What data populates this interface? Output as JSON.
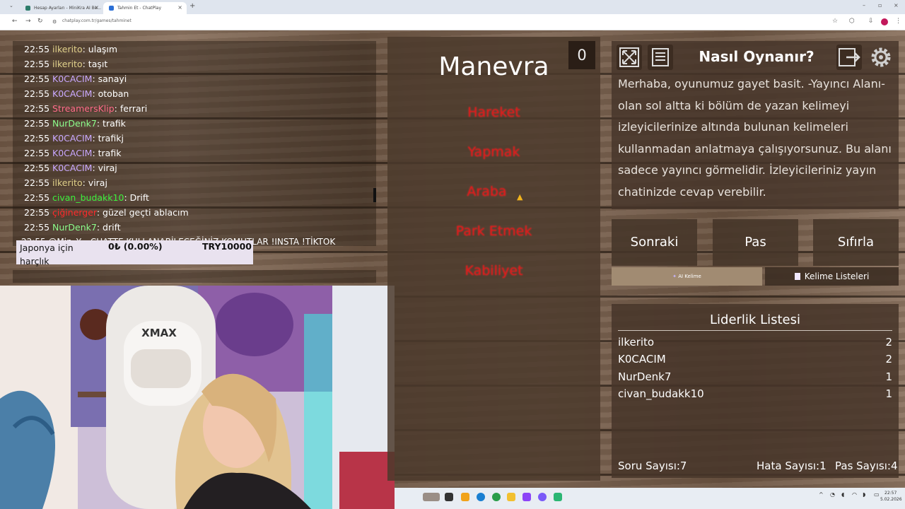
{
  "browser": {
    "tabs": [
      {
        "title": "Hesap Ayarları - MiniKra AI Bo...",
        "active": false
      },
      {
        "title": "Tahmin Et - ChatPlay",
        "active": true
      }
    ],
    "url": "chatplay.com.tr/games/tahminet"
  },
  "chat": {
    "messages": [
      {
        "time": "22:55",
        "user": "ilkerito",
        "color": "#e0d08a",
        "text": "ulaşım"
      },
      {
        "time": "22:55",
        "user": "ilkerito",
        "color": "#e0d08a",
        "text": "taşıt"
      },
      {
        "time": "22:55",
        "user": "K0CACIM",
        "color": "#c9a8ff",
        "text": "sanayi"
      },
      {
        "time": "22:55",
        "user": "K0CACIM",
        "color": "#c9a8ff",
        "text": "otoban"
      },
      {
        "time": "22:55",
        "user": "StreamersKlip",
        "color": "#ff6b8a",
        "text": "ferrari"
      },
      {
        "time": "22:55",
        "user": "NurDenk7",
        "color": "#8dff8d",
        "text": "trafik"
      },
      {
        "time": "22:55",
        "user": "K0CACIM",
        "color": "#c9a8ff",
        "text": "trafikj"
      },
      {
        "time": "22:55",
        "user": "K0CACIM",
        "color": "#c9a8ff",
        "text": "trafik"
      },
      {
        "time": "22:55",
        "user": "K0CACIM",
        "color": "#c9a8ff",
        "text": "viraj"
      },
      {
        "time": "22:55",
        "user": "ilkerito",
        "color": "#e0d08a",
        "text": "viraj"
      },
      {
        "time": "22:55",
        "user": "civan_budakk10",
        "color": "#3cf03c",
        "text": "Drift"
      },
      {
        "time": "22:55",
        "user": "çiğinerger",
        "color": "#ff2a2a",
        "text": "güzel geçti ablacım"
      },
      {
        "time": "22:55",
        "user": "NurDenk7",
        "color": "#8dff8d",
        "text": "drift"
      }
    ],
    "command_line": "22:55 @Min_Y... CHATTE KULLANABİLECEĞİNİZ KOMUTLAR !INSTA !TİKTOK",
    "donation": {
      "goal": "Japonya için harçlık",
      "amount": "0₺ (0.00%)",
      "target": "TRY10000"
    }
  },
  "game": {
    "main_word": "Manevra",
    "score": "0",
    "taboo_words": [
      "Hareket",
      "Yapmak",
      "Araba",
      "Park Etmek",
      "Kabiliyet"
    ],
    "how_to_title": "Nasıl Oynanır?",
    "how_to_text": "Merhaba, oyunumuz gayet basit. -Yayıncı Alanı- olan sol altta ki bölüm de yazan kelimeyi izleyicilerinize altında bulunan kelimeleri kullanmadan anlatmaya çalışıyorsunuz. Bu alanı sadece yayıncı görmelidir. İzleyicileriniz yayın chatinizde cevap verebilir.",
    "buttons": {
      "next": "Sonraki",
      "pass": "Pas",
      "reset": "Sıfırla"
    },
    "tabs": {
      "ai_word": "AI Kelime",
      "word_lists": "Kelime Listeleri"
    },
    "leaderboard": {
      "title": "Liderlik Listesi",
      "entries": [
        {
          "name": "ilkerito",
          "score": "2"
        },
        {
          "name": "K0CACIM",
          "score": "2"
        },
        {
          "name": "NurDenk7",
          "score": "1"
        },
        {
          "name": "civan_budakk10",
          "score": "1"
        }
      ]
    },
    "stats": {
      "questions": "Soru Sayısı:7",
      "errors": "Hata Sayısı:1",
      "passes": "Pas Sayısı:4"
    }
  },
  "taskbar": {
    "time": "22:57",
    "date": "5.02.2026"
  }
}
